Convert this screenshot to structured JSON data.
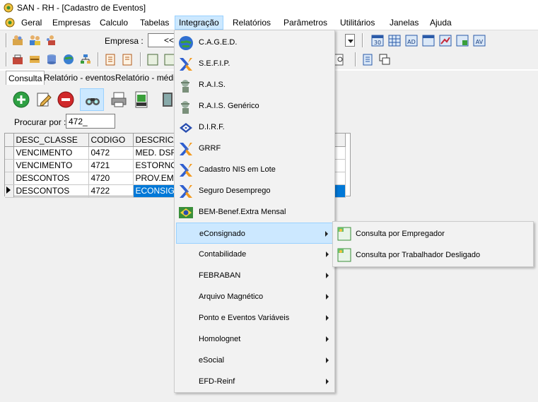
{
  "window": {
    "title": "SAN - RH - [Cadastro de Eventos]"
  },
  "menubar": {
    "items": [
      "Geral",
      "Empresas",
      "Calculo",
      "Tabelas",
      "Integração",
      "Relatórios",
      "Parâmetros",
      "Utilitários",
      "Janelas",
      "Ajuda"
    ],
    "active": "Integração"
  },
  "toolbar": {
    "empresa_label": "Empresa :",
    "empresa_value": "<<",
    "badges": [
      "30",
      "AD",
      "AV"
    ]
  },
  "tabs": [
    "Consulta",
    "Relatório - eventos",
    "Relatório - médias"
  ],
  "search": {
    "label": "Procurar por :",
    "value": "472_"
  },
  "grid": {
    "columns": [
      "DESC_CLASSE",
      "CODIGO",
      "DESCRICA"
    ],
    "rows": [
      [
        "VENCIMENTO",
        "0472",
        "MED. DSR"
      ],
      [
        "VENCIMENTO",
        "4721",
        "ESTORNO"
      ],
      [
        "DESCONTOS",
        "4720",
        "PROV.EMP"
      ],
      [
        "DESCONTOS",
        "4722",
        "ECONSIGN"
      ]
    ],
    "selected_row": 3
  },
  "integracao_menu": {
    "items": [
      {
        "label": "C.A.G.E.D.",
        "icon": "globe-icon",
        "submenu": false
      },
      {
        "label": "S.E.F.I.P.",
        "icon": "caixa-x-icon",
        "submenu": false
      },
      {
        "label": "R.A.I.S.",
        "icon": "rais-worker-icon",
        "submenu": false
      },
      {
        "label": "R.A.I.S. Genérico",
        "icon": "rais-worker-icon",
        "submenu": false
      },
      {
        "label": "D.I.R.F.",
        "icon": "receita-icon",
        "submenu": false
      },
      {
        "label": "GRRF",
        "icon": "caixa-x-icon",
        "submenu": false
      },
      {
        "label": "Cadastro NIS em Lote",
        "icon": "caixa-x-icon",
        "submenu": false
      },
      {
        "label": "Seguro Desemprego",
        "icon": "caixa-x-icon",
        "submenu": false
      },
      {
        "label": "BEM-Benef.Extra Mensal",
        "icon": "brazil-flag-icon",
        "submenu": false
      },
      {
        "label": "eConsignado",
        "icon": "",
        "submenu": true
      },
      {
        "label": "Contabilidade",
        "icon": "",
        "submenu": true
      },
      {
        "label": "FEBRABAN",
        "icon": "",
        "submenu": true
      },
      {
        "label": "Arquivo Magnético",
        "icon": "",
        "submenu": true
      },
      {
        "label": "Ponto e Eventos Variáveis",
        "icon": "",
        "submenu": true
      },
      {
        "label": "Homolognet",
        "icon": "",
        "submenu": true
      },
      {
        "label": "eSocial",
        "icon": "",
        "submenu": true
      },
      {
        "label": "EFD-Reinf",
        "icon": "",
        "submenu": true
      }
    ],
    "highlighted": "eConsignado"
  },
  "econsignado_submenu": {
    "items": [
      "Consulta por Empregador",
      "Consulta por Trabalhador Desligado"
    ]
  },
  "colors": {
    "highlight": "#cce8ff",
    "selection": "#0078d7",
    "caixa_blue": "#2f5fd0",
    "caixa_orange": "#f39a1e"
  }
}
